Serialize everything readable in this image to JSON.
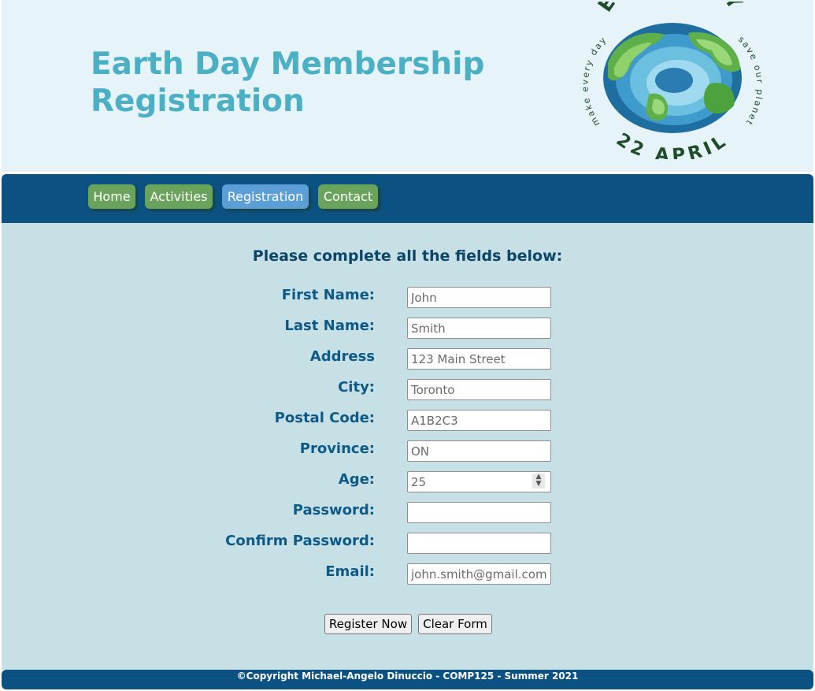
{
  "header": {
    "title": "Earth Day Membership Registration",
    "logo": {
      "top_text": "EARTH DAY",
      "left_arc_text": "make every day",
      "right_arc_text": "save our planet",
      "date_text": "22 APRIL",
      "colors": {
        "ocean": "#2a8fbf",
        "land": "#5fb04a",
        "text": "#1f4d2a"
      }
    }
  },
  "nav": {
    "items": [
      {
        "label": "Home"
      },
      {
        "label": "Activities"
      },
      {
        "label": "Registration"
      },
      {
        "label": "Contact"
      }
    ],
    "active": "Registration"
  },
  "form": {
    "heading": "Please complete all the fields below:",
    "fields": {
      "first_name": {
        "label": "First Name:",
        "placeholder": "John"
      },
      "last_name": {
        "label": "Last Name:",
        "placeholder": "Smith"
      },
      "address": {
        "label": "Address",
        "placeholder": "123 Main Street"
      },
      "city": {
        "label": "City:",
        "placeholder": "Toronto"
      },
      "postal_code": {
        "label": "Postal Code:",
        "placeholder": "A1B2C3"
      },
      "province": {
        "label": "Province:",
        "placeholder": "ON"
      },
      "age": {
        "label": "Age:",
        "placeholder": "25"
      },
      "password": {
        "label": "Password:",
        "placeholder": ""
      },
      "confirm_password": {
        "label": "Confirm Password:",
        "placeholder": ""
      },
      "email": {
        "label": "Email:",
        "placeholder": "john.smith@gmail.com"
      }
    },
    "buttons": {
      "register": "Register Now",
      "clear": "Clear Form"
    }
  },
  "footer": {
    "text": "©Copyright Michael-Angelo Dinuccio - COMP125 - Summer 2021"
  },
  "colors": {
    "header_bg": "#e6f3f9",
    "title": "#4bb0c4",
    "nav_bg": "#0b5282",
    "nav_button": "#6aa35c",
    "nav_button_active": "#5b9fd6",
    "main_bg": "#c6e0e5",
    "label": "#0e5a86"
  }
}
